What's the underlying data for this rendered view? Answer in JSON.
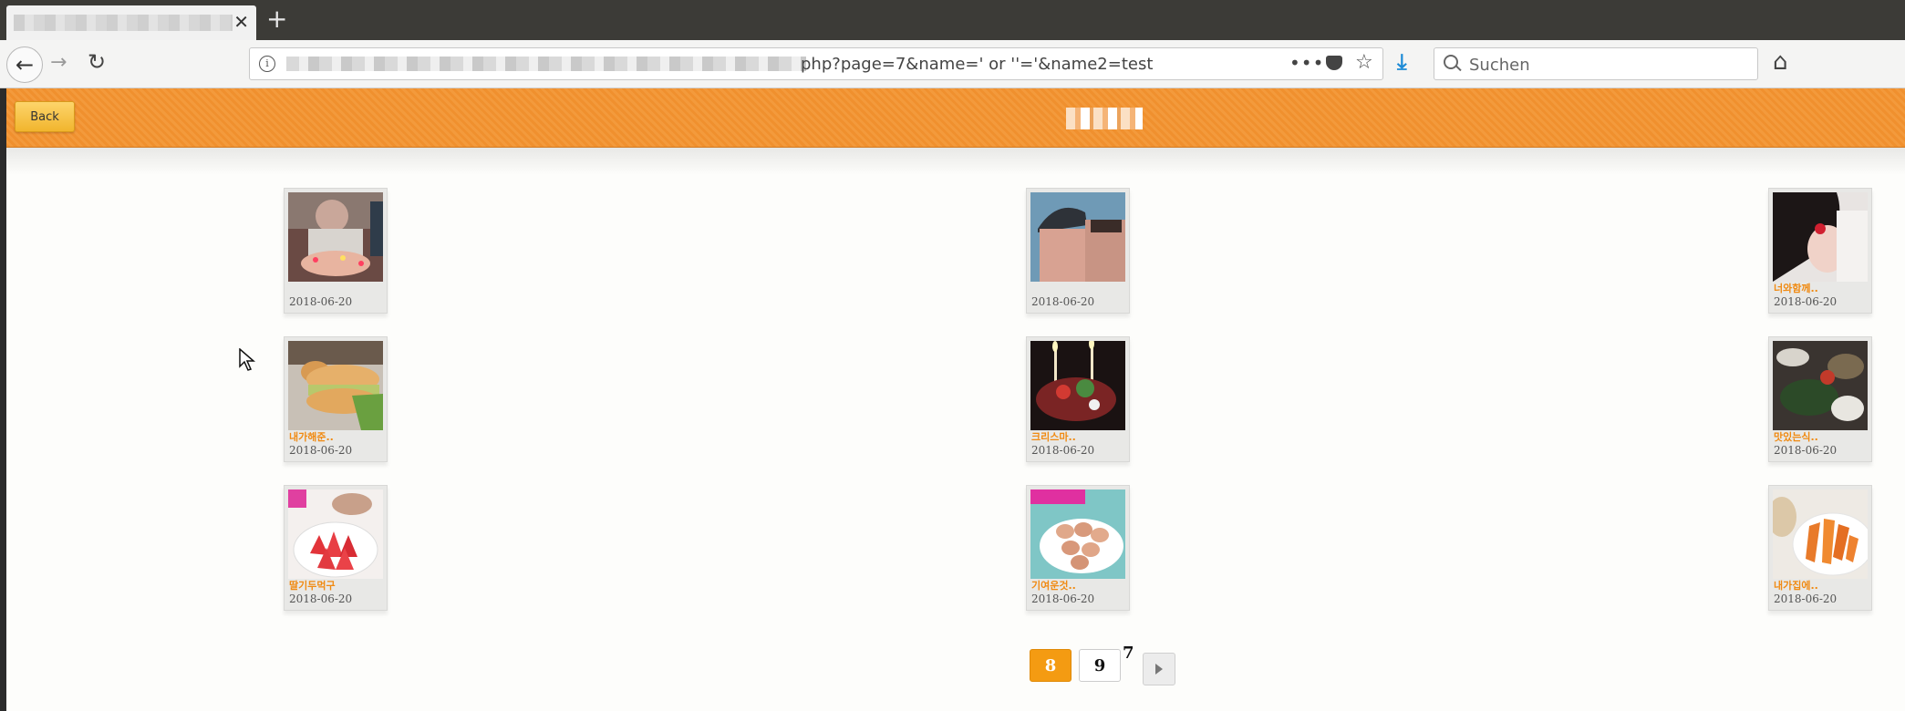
{
  "browser": {
    "tab": {
      "title": "",
      "close": "✕"
    },
    "new_tab": "+",
    "url_visible": "php?page=7&name=' or ''='&name2=test",
    "more_actions": "•••",
    "search_placeholder": "Suchen"
  },
  "page": {
    "back_label": "Back",
    "title": "",
    "header_color": "#f0902e",
    "accent_color": "#f49b12"
  },
  "gallery": [
    {
      "title": "",
      "date": "2018-06-20"
    },
    {
      "title": "",
      "date": "2018-06-20"
    },
    {
      "title": "너와함께..",
      "date": "2018-06-20"
    },
    {
      "title": "내가해준..",
      "date": "2018-06-20"
    },
    {
      "title": "크리스마..",
      "date": "2018-06-20"
    },
    {
      "title": "맛있는식..",
      "date": "2018-06-20"
    },
    {
      "title": "딸기두먹구",
      "date": "2018-06-20"
    },
    {
      "title": "기여운것..",
      "date": "2018-06-20"
    },
    {
      "title": "내가집에..",
      "date": "2018-06-20"
    }
  ],
  "pagination": {
    "current": "8",
    "next_page": "9",
    "extra": "7"
  }
}
